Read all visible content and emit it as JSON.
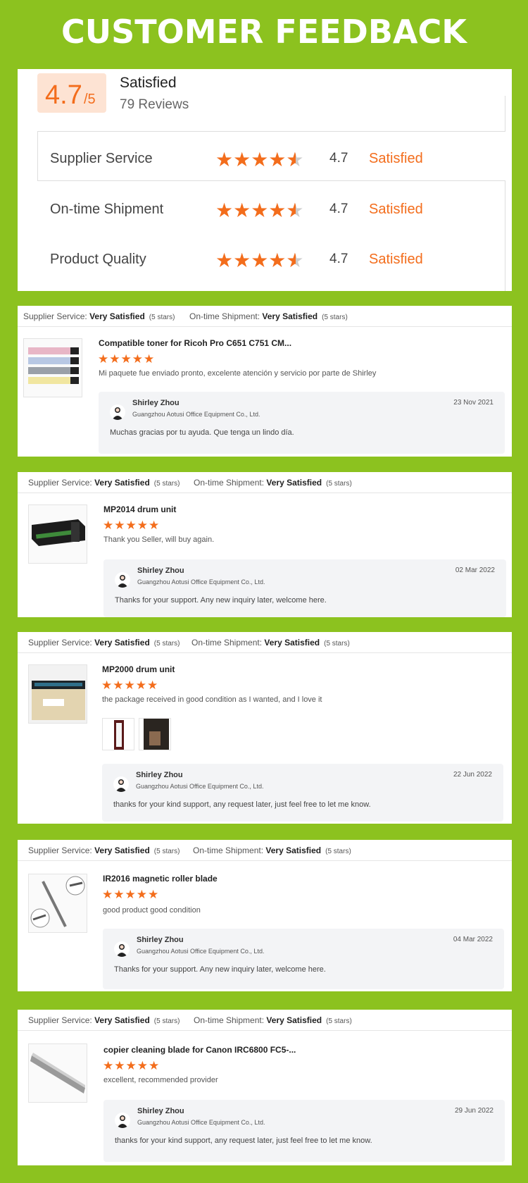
{
  "page_title": "CUSTOMER FEEDBACK",
  "summary": {
    "score": "4.7",
    "score_out_of": "/5",
    "label": "Satisfied",
    "reviews": "79 Reviews",
    "ratings": [
      {
        "name": "Supplier Service",
        "value": "4.7",
        "status": "Satisfied",
        "stars": 4.7
      },
      {
        "name": "On-time Shipment",
        "value": "4.7",
        "status": "Satisfied",
        "stars": 4.7
      },
      {
        "name": "Product Quality",
        "value": "4.7",
        "status": "Satisfied",
        "stars": 4.7
      }
    ]
  },
  "labels": {
    "supplier_service": "Supplier Service:",
    "ontime_shipment": "On-time Shipment:",
    "very_satisfied": "Very Satisfied",
    "five_stars": "(5 stars)"
  },
  "colors": {
    "background": "#8cc21f",
    "accent": "#f36d1c"
  },
  "reviews": [
    {
      "product": "Compatible toner for Ricoh Pro C651 C751 CM...",
      "stars": 5,
      "text": "Mi paquete fue enviado pronto, excelente atención y servicio por parte de Shirley",
      "thumb_icon": "toner-cartridges-image",
      "reply": {
        "name": "Shirley Zhou",
        "company": "Guangzhou Aotusi Office Equipment Co., Ltd.",
        "date": "23 Nov 2021",
        "text": "Muchas gracias por tu ayuda. Que tenga un lindo día."
      }
    },
    {
      "product": "MP2014 drum unit",
      "stars": 5,
      "text": "Thank you Seller, will buy again.",
      "thumb_icon": "drum-unit-image",
      "reply": {
        "name": "Shirley Zhou",
        "company": "Guangzhou Aotusi Office Equipment Co., Ltd.",
        "date": "02 Mar 2022",
        "text": "Thanks for your support. Any new inquiry later, welcome here."
      }
    },
    {
      "product": "MP2000 drum unit",
      "stars": 5,
      "text": "the package received in good condition as I wanted, and I love it",
      "thumb_icon": "drum-box-image",
      "reply": {
        "name": "Shirley Zhou",
        "company": "Guangzhou Aotusi Office Equipment Co., Ltd.",
        "date": "22 Jun 2022",
        "text": "thanks for your kind support, any request later, just feel free to let me know."
      }
    },
    {
      "product": "IR2016 magnetic roller blade",
      "stars": 5,
      "text": "good product good condition",
      "thumb_icon": "roller-blade-image",
      "reply": {
        "name": "Shirley Zhou",
        "company": "Guangzhou Aotusi Office Equipment Co., Ltd.",
        "date": "04 Mar 2022",
        "text": "Thanks for your support. Any new inquiry later, welcome here."
      }
    },
    {
      "product": "copier cleaning blade for Canon IRC6800 FC5-...",
      "stars": 5,
      "text": "excellent, recommended provider",
      "thumb_icon": "cleaning-blade-image",
      "reply": {
        "name": "Shirley Zhou",
        "company": "Guangzhou Aotusi Office Equipment Co., Ltd.",
        "date": "29 Jun 2022",
        "text": "thanks for your kind support, any request later, just feel free to let me know."
      }
    }
  ]
}
